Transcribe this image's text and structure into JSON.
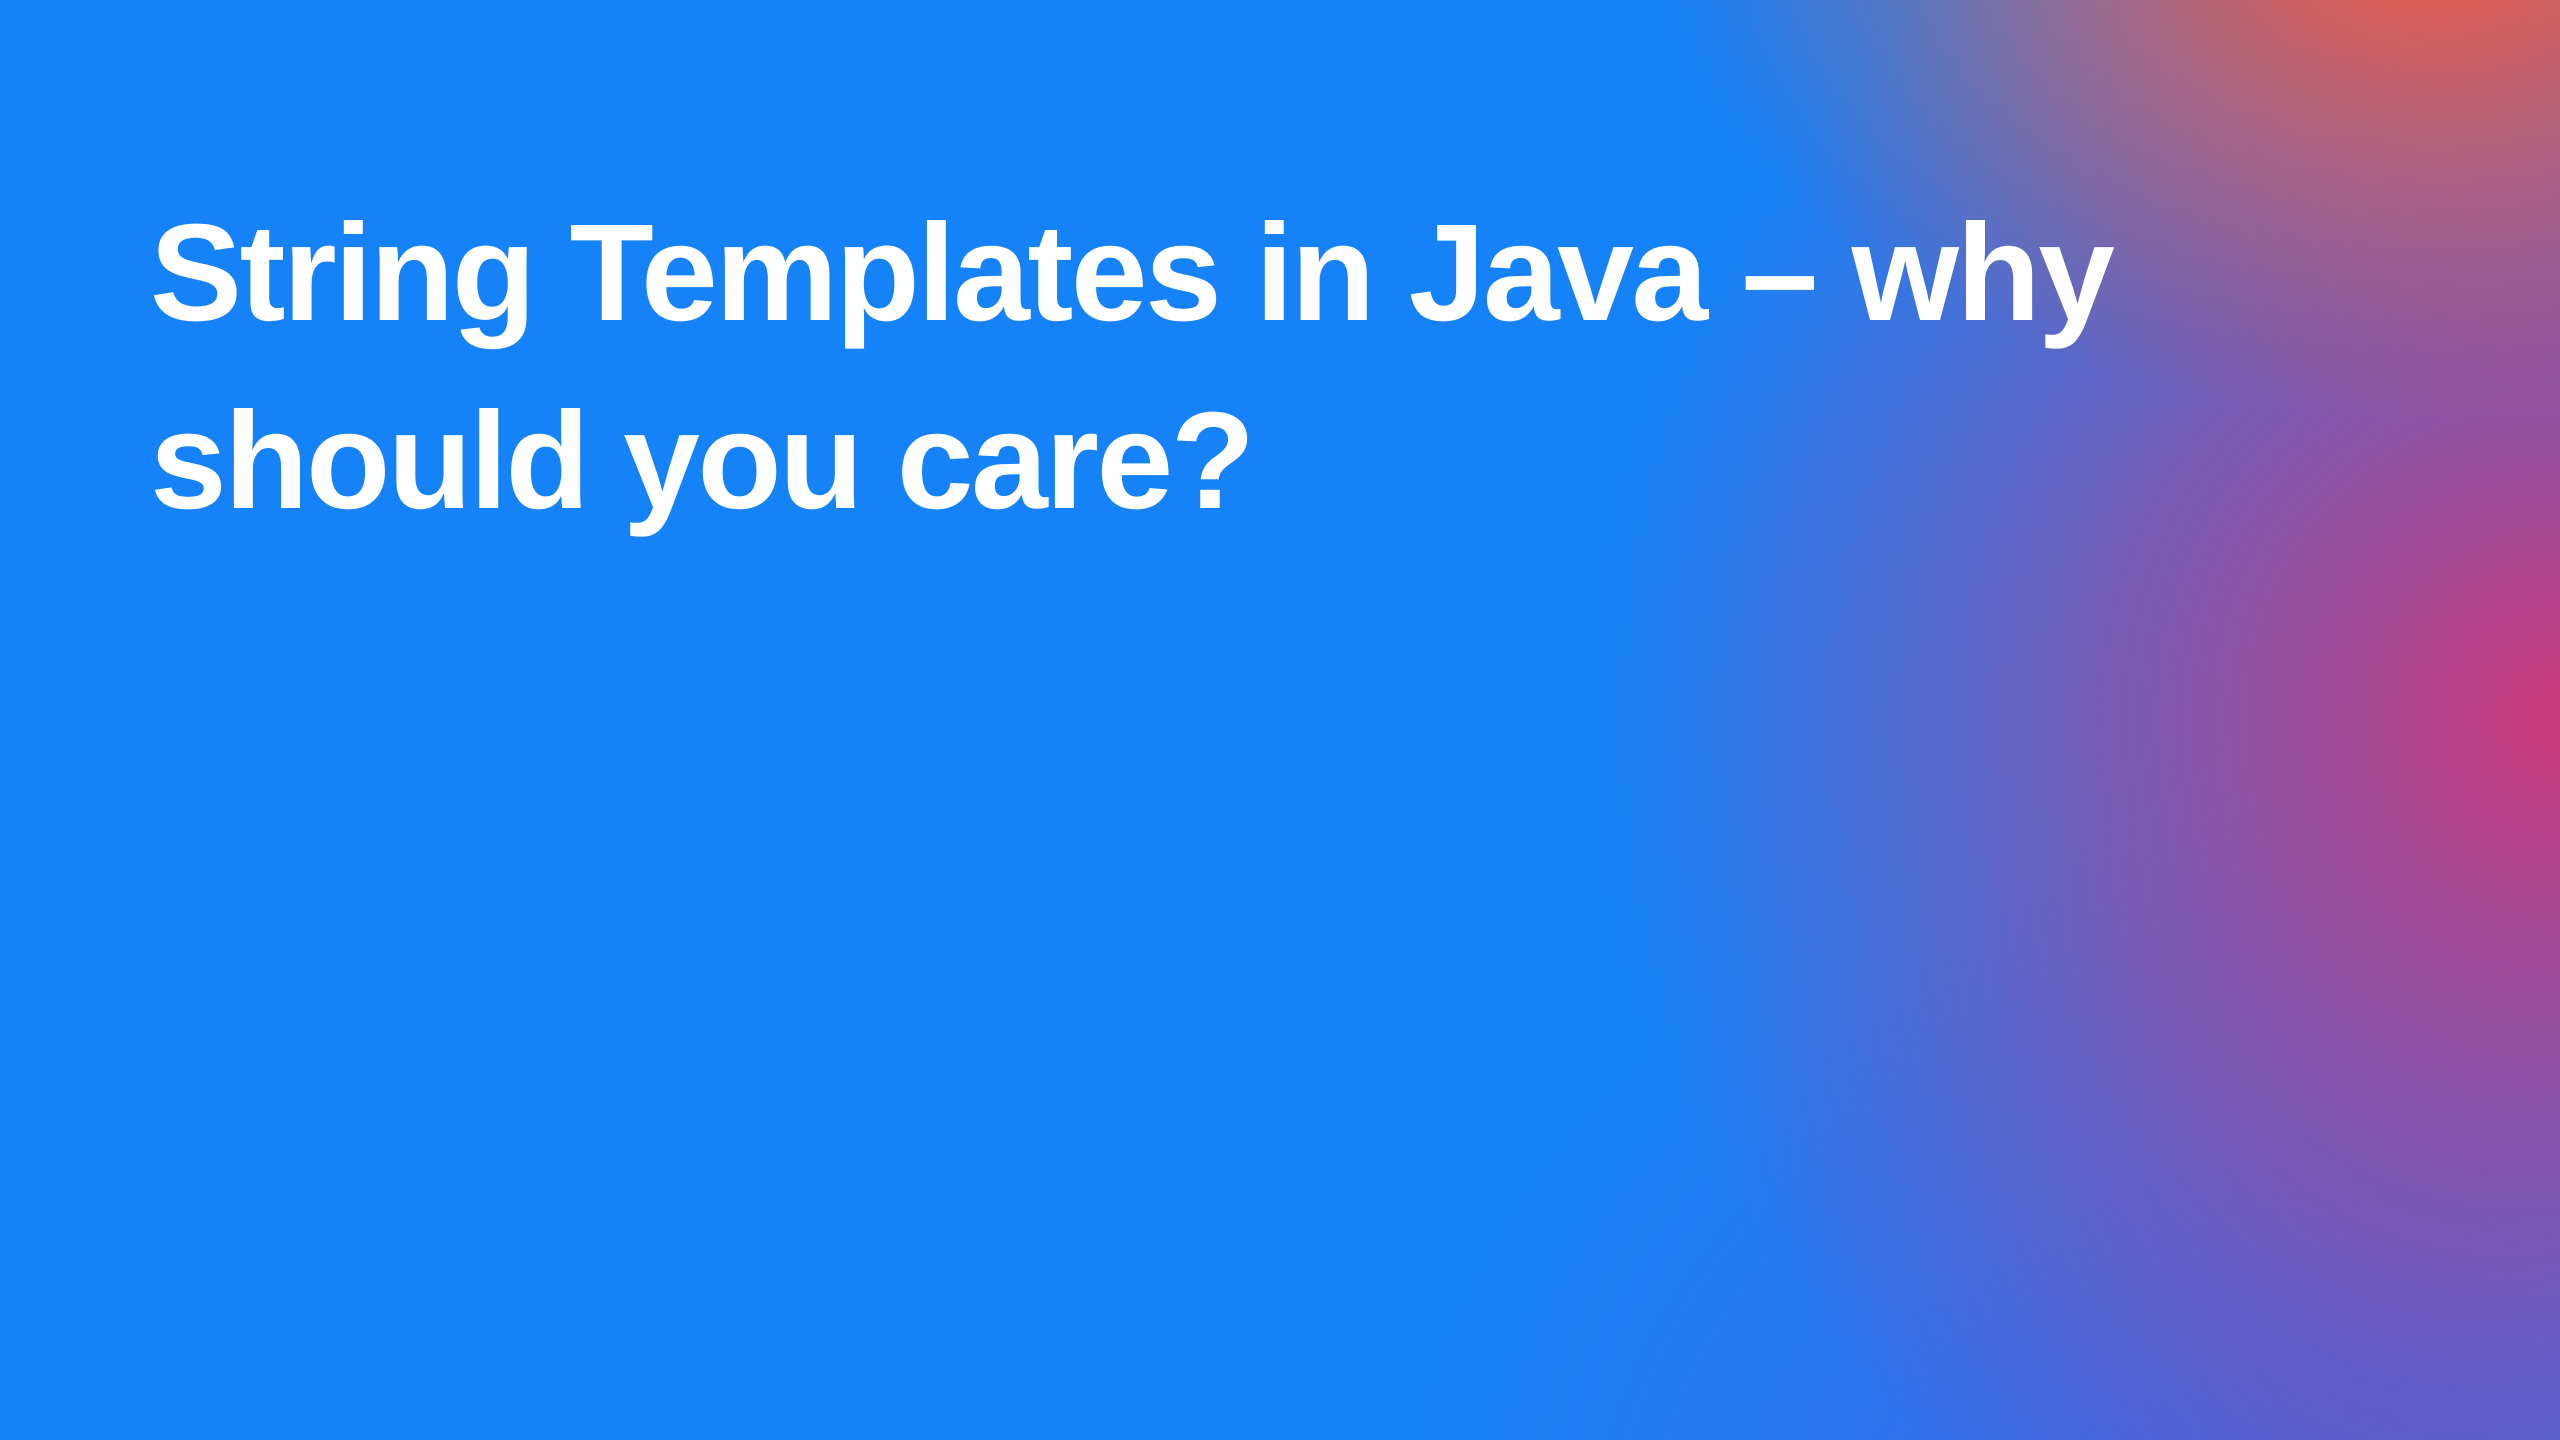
{
  "slide": {
    "title": "String Templates in Java – why should you care?"
  }
}
